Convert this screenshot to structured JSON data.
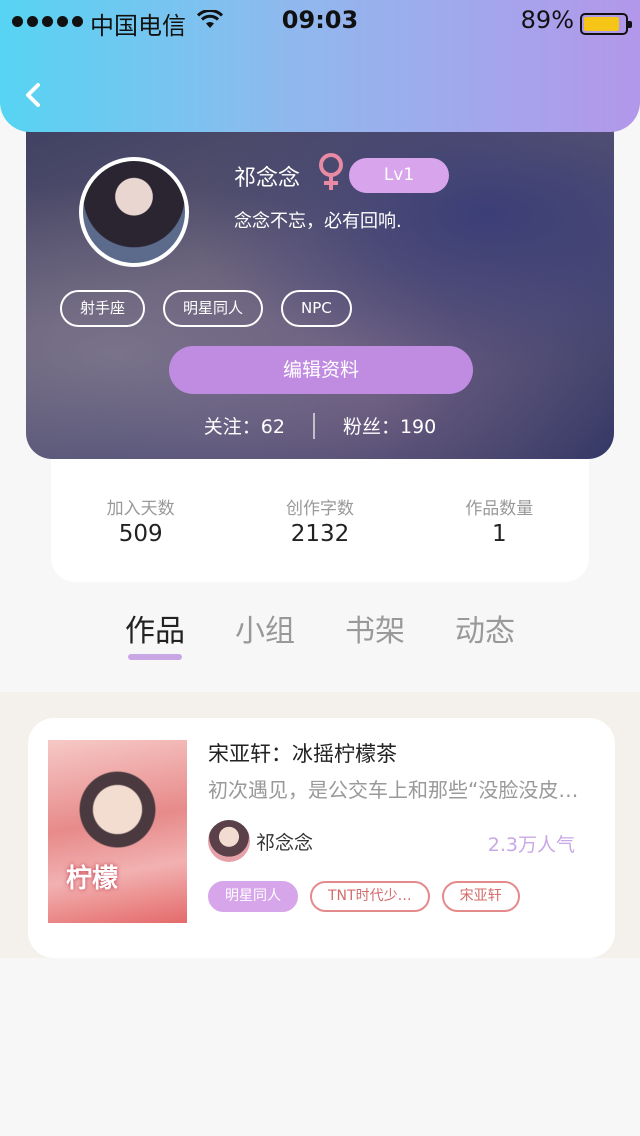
{
  "status_bar": {
    "carrier": "中国电信",
    "time": "09:03",
    "battery_percent": "89%",
    "battery_level": 0.89
  },
  "nav": {
    "back_icon": "chevron-left-icon"
  },
  "profile": {
    "name": "祁念念",
    "gender_icon": "female-icon",
    "level": "Lv1",
    "bio": "念念不忘，必有回响.",
    "tags": [
      "射手座",
      "明星同人",
      "NPC"
    ],
    "edit_button": "编辑资料",
    "following": "关注：62",
    "followers": "粉丝：190"
  },
  "stats": [
    {
      "label": "加入天数",
      "value": "509"
    },
    {
      "label": "创作字数",
      "value": "2132"
    },
    {
      "label": "作品数量",
      "value": "1"
    }
  ],
  "tabs": [
    {
      "label": "作品",
      "active": true
    },
    {
      "label": "小组",
      "active": false
    },
    {
      "label": "书架",
      "active": false
    },
    {
      "label": "动态",
      "active": false
    }
  ],
  "works": [
    {
      "title": "宋亚轩：冰摇柠檬茶",
      "description": "初次遇见，是公交车上和那些“没脸没皮…",
      "author": "祁念念",
      "popularity": "2.3万人气",
      "tags": [
        {
          "label": "明星同人",
          "style": "solid"
        },
        {
          "label": "TNT时代少…",
          "style": "outline"
        },
        {
          "label": "宋亚轩",
          "style": "outline"
        }
      ]
    }
  ],
  "colors": {
    "header_gradient_start": "#57d4f3",
    "header_gradient_end": "#b397ea",
    "accent_purple": "#c08ce2",
    "tag_red": "#e58a8a",
    "gender_pink": "#e88aa3"
  }
}
